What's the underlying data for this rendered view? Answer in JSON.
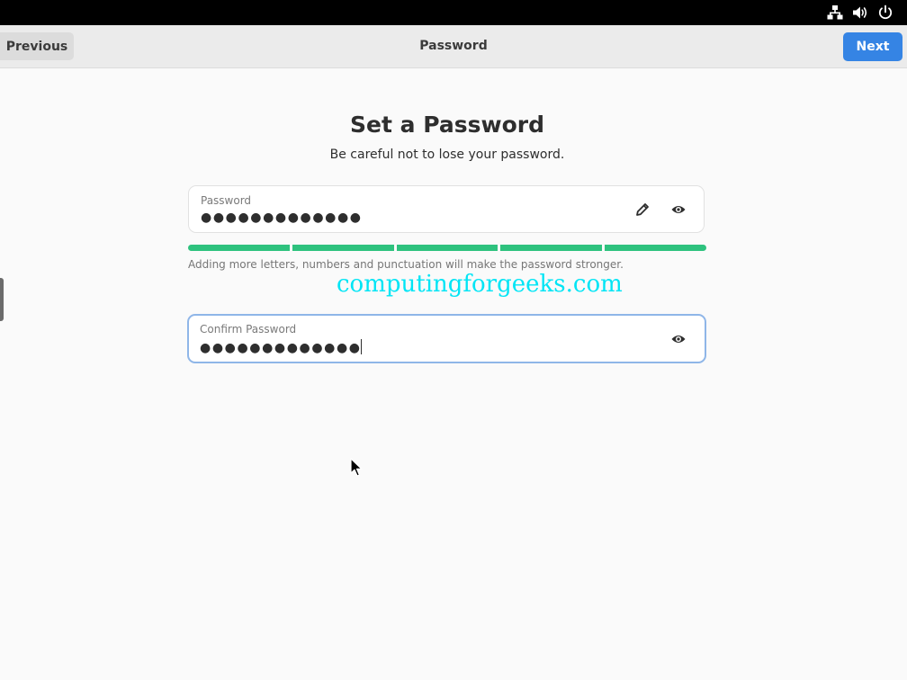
{
  "system_bar": {
    "icons": [
      "network-wired-icon",
      "volume-icon",
      "power-icon"
    ]
  },
  "header": {
    "title": "Password",
    "previous_label": "Previous",
    "next_label": "Next",
    "accent_color": "#3584e4"
  },
  "main": {
    "heading": "Set a Password",
    "subtitle": "Be careful not to lose your password.",
    "password_field": {
      "label": "Password",
      "value": "●●●●●●●●●●●●●",
      "icons": [
        "edit-pencil-icon",
        "show-password-eye-icon"
      ]
    },
    "strength_meter": {
      "segments_total": 5,
      "segments_filled": 5,
      "color": "#2ec27e"
    },
    "hint": "Adding more letters, numbers and punctuation will make the password stronger.",
    "watermark": "computingforgeeks.com",
    "confirm_field": {
      "label": "Confirm Password",
      "value": "●●●●●●●●●●●●●",
      "icons": [
        "show-password-eye-icon"
      ]
    }
  }
}
